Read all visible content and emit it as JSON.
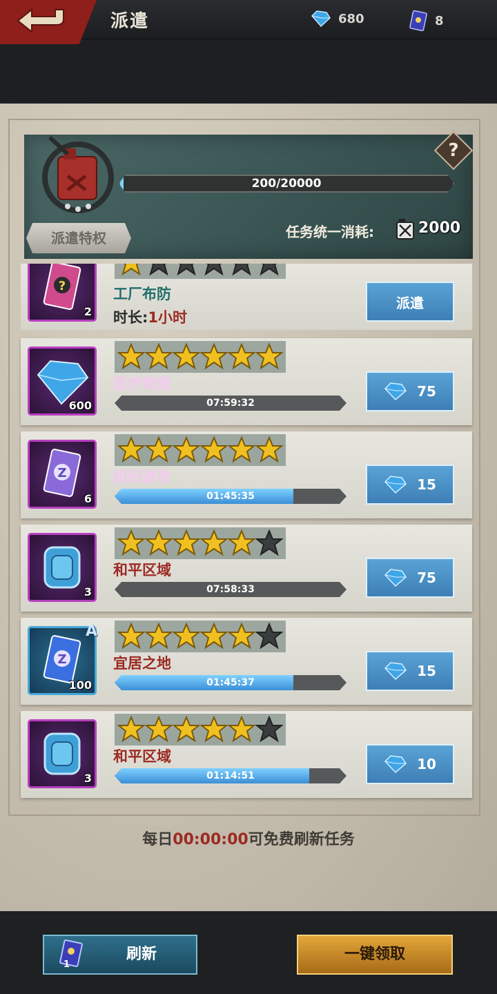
{
  "header": {
    "title": "派遣",
    "gems": "680",
    "tickets": "8"
  },
  "energy": {
    "display": "200/20000",
    "fraction": 0.01,
    "cost_label": "任务统一消耗:",
    "cost_value": "2000",
    "privilege_label": "派遣特权"
  },
  "missions": [
    {
      "name": "工厂布防",
      "name_color": "#1f6e6a",
      "stars": 1,
      "item_count": "2",
      "duration_label": "时长:",
      "duration_value": "1小时",
      "button_label": "派遣"
    },
    {
      "name": "医疗物资",
      "name_color": "#f3c9f0",
      "stars": 6,
      "item_count": "600",
      "timer": "07:59:32",
      "progress": 0,
      "button_value": "75"
    },
    {
      "name": "组织进攻",
      "name_color": "#f3c9f0",
      "stars": 6,
      "item_count": "6",
      "timer": "01:45:35",
      "progress": 0.77,
      "button_value": "15"
    },
    {
      "name": "和平区域",
      "name_color": "#9b2a22",
      "stars": 5,
      "item_count": "3",
      "timer": "07:58:33",
      "progress": 0,
      "button_value": "75"
    },
    {
      "name": "宜居之地",
      "name_color": "#9b2a22",
      "stars": 5,
      "item_count": "100",
      "item_grade": "A",
      "timer": "01:45:37",
      "progress": 0.77,
      "button_value": "15"
    },
    {
      "name": "和平区域",
      "name_color": "#9b2a22",
      "stars": 5,
      "item_count": "3",
      "timer": "01:14:51",
      "progress": 0.84,
      "button_value": "10"
    }
  ],
  "footer": {
    "hint_prefix": "每日",
    "hint_time": "00:00:00",
    "hint_suffix": "可免费刷新任务",
    "refresh_label": "刷新",
    "refresh_count": "1",
    "claim_label": "一键领取"
  },
  "colors": {
    "gem": "#3fa6e8",
    "star": "#f0c020",
    "accent_red": "#9b2a22"
  }
}
